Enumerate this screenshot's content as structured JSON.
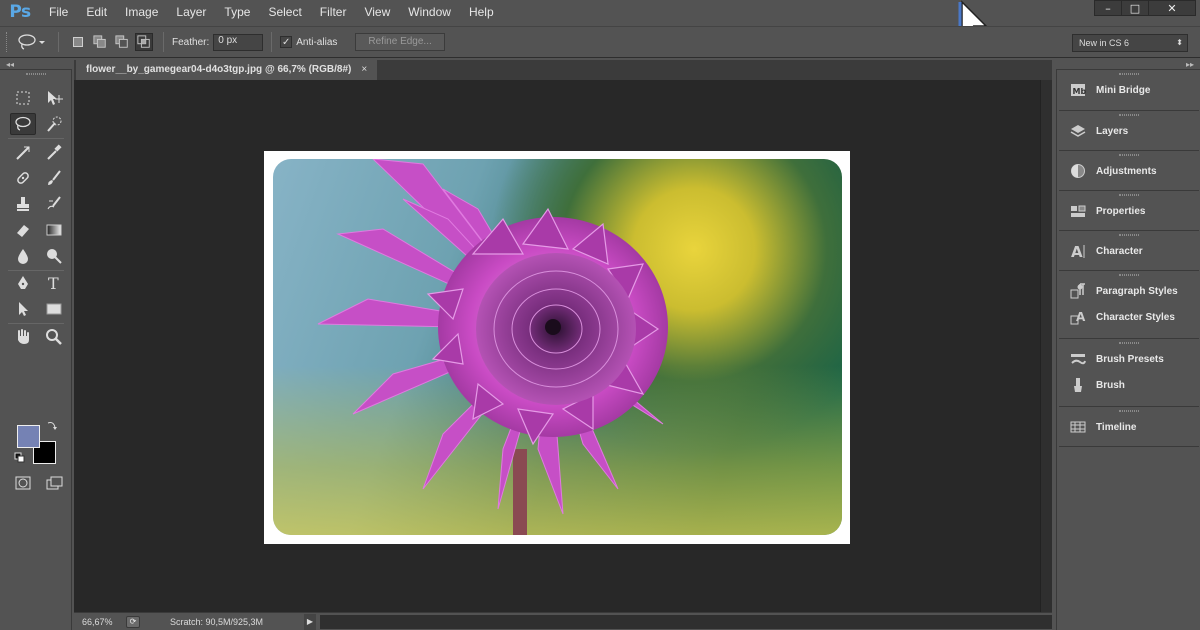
{
  "app": {
    "logo": "Ps"
  },
  "menu": [
    "File",
    "Edit",
    "Image",
    "Layer",
    "Type",
    "Select",
    "Filter",
    "View",
    "Window",
    "Help"
  ],
  "window_controls": {
    "minimize": "–",
    "maximize": "□",
    "close": "✕"
  },
  "options_bar": {
    "feather_label": "Feather:",
    "feather_value": "0 px",
    "antialias_label": "Anti-alias",
    "antialias_checked": true,
    "refine_label": "Refine Edge...",
    "workspace_value": "New in CS 6"
  },
  "document": {
    "tab_title": "flower__by_gamegear04-d4o3tgp.jpg @ 66,7% (RGB/8#)",
    "close_glyph": "×"
  },
  "status": {
    "zoom": "66,67%",
    "scratch": "Scratch: 90,5M/925,3M"
  },
  "colors": {
    "foreground": "#7582b4",
    "background": "#000000",
    "accent": "#5aa8e6"
  },
  "tools": [
    "rectangular-marquee-icon",
    "move-icon",
    "lasso-icon",
    "quick-selection-icon",
    "crop-icon",
    "eyedropper-icon",
    "spot-healing-icon",
    "brush-icon",
    "clone-stamp-icon",
    "history-brush-icon",
    "eraser-icon",
    "gradient-icon",
    "blur-icon",
    "dodge-icon",
    "pen-icon",
    "type-icon",
    "path-selection-icon",
    "rectangle-shape-icon",
    "hand-icon",
    "zoom-icon",
    "quick-mask-icon",
    "screen-mode-icon"
  ],
  "dock": {
    "groups": [
      [
        {
          "label": "Mini Bridge",
          "icon": "mini-bridge-icon"
        }
      ],
      [
        {
          "label": "Layers",
          "icon": "layers-icon"
        }
      ],
      [
        {
          "label": "Adjustments",
          "icon": "adjustments-icon"
        }
      ],
      [
        {
          "label": "Properties",
          "icon": "properties-icon"
        }
      ],
      [
        {
          "label": "Character",
          "icon": "character-icon"
        }
      ],
      [
        {
          "label": "Paragraph Styles",
          "icon": "paragraph-styles-icon"
        },
        {
          "label": "Character Styles",
          "icon": "character-styles-icon"
        }
      ],
      [
        {
          "label": "Brush Presets",
          "icon": "brush-presets-icon"
        },
        {
          "label": "Brush",
          "icon": "brush-panel-icon"
        }
      ],
      [
        {
          "label": "Timeline",
          "icon": "timeline-icon"
        }
      ]
    ]
  }
}
